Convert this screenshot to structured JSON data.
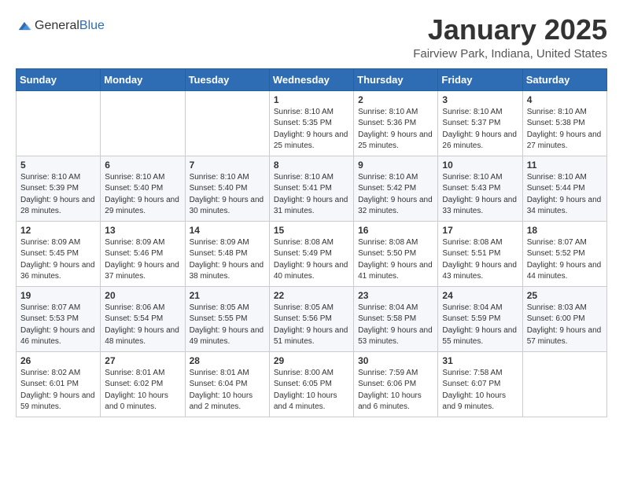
{
  "header": {
    "logo_general": "General",
    "logo_blue": "Blue",
    "title": "January 2025",
    "location": "Fairview Park, Indiana, United States"
  },
  "columns": [
    "Sunday",
    "Monday",
    "Tuesday",
    "Wednesday",
    "Thursday",
    "Friday",
    "Saturday"
  ],
  "weeks": [
    [
      {
        "day": "",
        "sunrise": "",
        "sunset": "",
        "daylight": ""
      },
      {
        "day": "",
        "sunrise": "",
        "sunset": "",
        "daylight": ""
      },
      {
        "day": "",
        "sunrise": "",
        "sunset": "",
        "daylight": ""
      },
      {
        "day": "1",
        "sunrise": "Sunrise: 8:10 AM",
        "sunset": "Sunset: 5:35 PM",
        "daylight": "Daylight: 9 hours and 25 minutes."
      },
      {
        "day": "2",
        "sunrise": "Sunrise: 8:10 AM",
        "sunset": "Sunset: 5:36 PM",
        "daylight": "Daylight: 9 hours and 25 minutes."
      },
      {
        "day": "3",
        "sunrise": "Sunrise: 8:10 AM",
        "sunset": "Sunset: 5:37 PM",
        "daylight": "Daylight: 9 hours and 26 minutes."
      },
      {
        "day": "4",
        "sunrise": "Sunrise: 8:10 AM",
        "sunset": "Sunset: 5:38 PM",
        "daylight": "Daylight: 9 hours and 27 minutes."
      }
    ],
    [
      {
        "day": "5",
        "sunrise": "Sunrise: 8:10 AM",
        "sunset": "Sunset: 5:39 PM",
        "daylight": "Daylight: 9 hours and 28 minutes."
      },
      {
        "day": "6",
        "sunrise": "Sunrise: 8:10 AM",
        "sunset": "Sunset: 5:40 PM",
        "daylight": "Daylight: 9 hours and 29 minutes."
      },
      {
        "day": "7",
        "sunrise": "Sunrise: 8:10 AM",
        "sunset": "Sunset: 5:40 PM",
        "daylight": "Daylight: 9 hours and 30 minutes."
      },
      {
        "day": "8",
        "sunrise": "Sunrise: 8:10 AM",
        "sunset": "Sunset: 5:41 PM",
        "daylight": "Daylight: 9 hours and 31 minutes."
      },
      {
        "day": "9",
        "sunrise": "Sunrise: 8:10 AM",
        "sunset": "Sunset: 5:42 PM",
        "daylight": "Daylight: 9 hours and 32 minutes."
      },
      {
        "day": "10",
        "sunrise": "Sunrise: 8:10 AM",
        "sunset": "Sunset: 5:43 PM",
        "daylight": "Daylight: 9 hours and 33 minutes."
      },
      {
        "day": "11",
        "sunrise": "Sunrise: 8:10 AM",
        "sunset": "Sunset: 5:44 PM",
        "daylight": "Daylight: 9 hours and 34 minutes."
      }
    ],
    [
      {
        "day": "12",
        "sunrise": "Sunrise: 8:09 AM",
        "sunset": "Sunset: 5:45 PM",
        "daylight": "Daylight: 9 hours and 36 minutes."
      },
      {
        "day": "13",
        "sunrise": "Sunrise: 8:09 AM",
        "sunset": "Sunset: 5:46 PM",
        "daylight": "Daylight: 9 hours and 37 minutes."
      },
      {
        "day": "14",
        "sunrise": "Sunrise: 8:09 AM",
        "sunset": "Sunset: 5:48 PM",
        "daylight": "Daylight: 9 hours and 38 minutes."
      },
      {
        "day": "15",
        "sunrise": "Sunrise: 8:08 AM",
        "sunset": "Sunset: 5:49 PM",
        "daylight": "Daylight: 9 hours and 40 minutes."
      },
      {
        "day": "16",
        "sunrise": "Sunrise: 8:08 AM",
        "sunset": "Sunset: 5:50 PM",
        "daylight": "Daylight: 9 hours and 41 minutes."
      },
      {
        "day": "17",
        "sunrise": "Sunrise: 8:08 AM",
        "sunset": "Sunset: 5:51 PM",
        "daylight": "Daylight: 9 hours and 43 minutes."
      },
      {
        "day": "18",
        "sunrise": "Sunrise: 8:07 AM",
        "sunset": "Sunset: 5:52 PM",
        "daylight": "Daylight: 9 hours and 44 minutes."
      }
    ],
    [
      {
        "day": "19",
        "sunrise": "Sunrise: 8:07 AM",
        "sunset": "Sunset: 5:53 PM",
        "daylight": "Daylight: 9 hours and 46 minutes."
      },
      {
        "day": "20",
        "sunrise": "Sunrise: 8:06 AM",
        "sunset": "Sunset: 5:54 PM",
        "daylight": "Daylight: 9 hours and 48 minutes."
      },
      {
        "day": "21",
        "sunrise": "Sunrise: 8:05 AM",
        "sunset": "Sunset: 5:55 PM",
        "daylight": "Daylight: 9 hours and 49 minutes."
      },
      {
        "day": "22",
        "sunrise": "Sunrise: 8:05 AM",
        "sunset": "Sunset: 5:56 PM",
        "daylight": "Daylight: 9 hours and 51 minutes."
      },
      {
        "day": "23",
        "sunrise": "Sunrise: 8:04 AM",
        "sunset": "Sunset: 5:58 PM",
        "daylight": "Daylight: 9 hours and 53 minutes."
      },
      {
        "day": "24",
        "sunrise": "Sunrise: 8:04 AM",
        "sunset": "Sunset: 5:59 PM",
        "daylight": "Daylight: 9 hours and 55 minutes."
      },
      {
        "day": "25",
        "sunrise": "Sunrise: 8:03 AM",
        "sunset": "Sunset: 6:00 PM",
        "daylight": "Daylight: 9 hours and 57 minutes."
      }
    ],
    [
      {
        "day": "26",
        "sunrise": "Sunrise: 8:02 AM",
        "sunset": "Sunset: 6:01 PM",
        "daylight": "Daylight: 9 hours and 59 minutes."
      },
      {
        "day": "27",
        "sunrise": "Sunrise: 8:01 AM",
        "sunset": "Sunset: 6:02 PM",
        "daylight": "Daylight: 10 hours and 0 minutes."
      },
      {
        "day": "28",
        "sunrise": "Sunrise: 8:01 AM",
        "sunset": "Sunset: 6:04 PM",
        "daylight": "Daylight: 10 hours and 2 minutes."
      },
      {
        "day": "29",
        "sunrise": "Sunrise: 8:00 AM",
        "sunset": "Sunset: 6:05 PM",
        "daylight": "Daylight: 10 hours and 4 minutes."
      },
      {
        "day": "30",
        "sunrise": "Sunrise: 7:59 AM",
        "sunset": "Sunset: 6:06 PM",
        "daylight": "Daylight: 10 hours and 6 minutes."
      },
      {
        "day": "31",
        "sunrise": "Sunrise: 7:58 AM",
        "sunset": "Sunset: 6:07 PM",
        "daylight": "Daylight: 10 hours and 9 minutes."
      },
      {
        "day": "",
        "sunrise": "",
        "sunset": "",
        "daylight": ""
      }
    ]
  ]
}
